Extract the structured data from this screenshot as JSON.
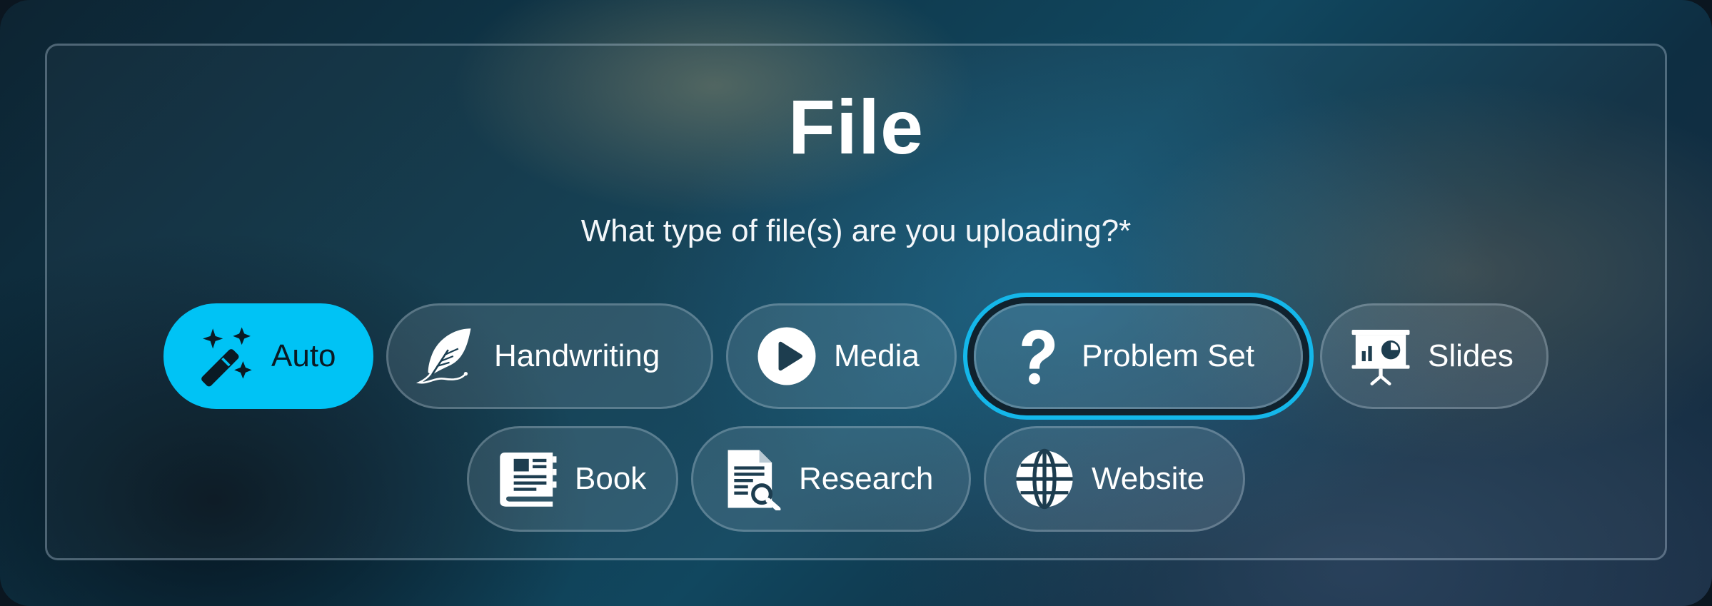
{
  "dialog": {
    "title": "File",
    "question": "What type of file(s) are you uploading?*"
  },
  "options": [
    {
      "label": "Auto",
      "icon": "magic-wand-icon",
      "state": "selected"
    },
    {
      "label": "Handwriting",
      "icon": "feather-quill-icon",
      "state": "default"
    },
    {
      "label": "Media",
      "icon": "play-circle-icon",
      "state": "default"
    },
    {
      "label": "Problem Set",
      "icon": "question-mark-icon",
      "state": "focused"
    },
    {
      "label": "Slides",
      "icon": "presentation-board-icon",
      "state": "default"
    },
    {
      "label": "Book",
      "icon": "book-icon",
      "state": "default"
    },
    {
      "label": "Research",
      "icon": "document-search-icon",
      "state": "default"
    },
    {
      "label": "Website",
      "icon": "globe-icon",
      "state": "default"
    }
  ],
  "colors": {
    "selected_fill": "#00c3f5",
    "focus_ring": "#14b7ea",
    "chip_border": "rgba(200,220,230,0.28)",
    "text": "#ffffff"
  }
}
